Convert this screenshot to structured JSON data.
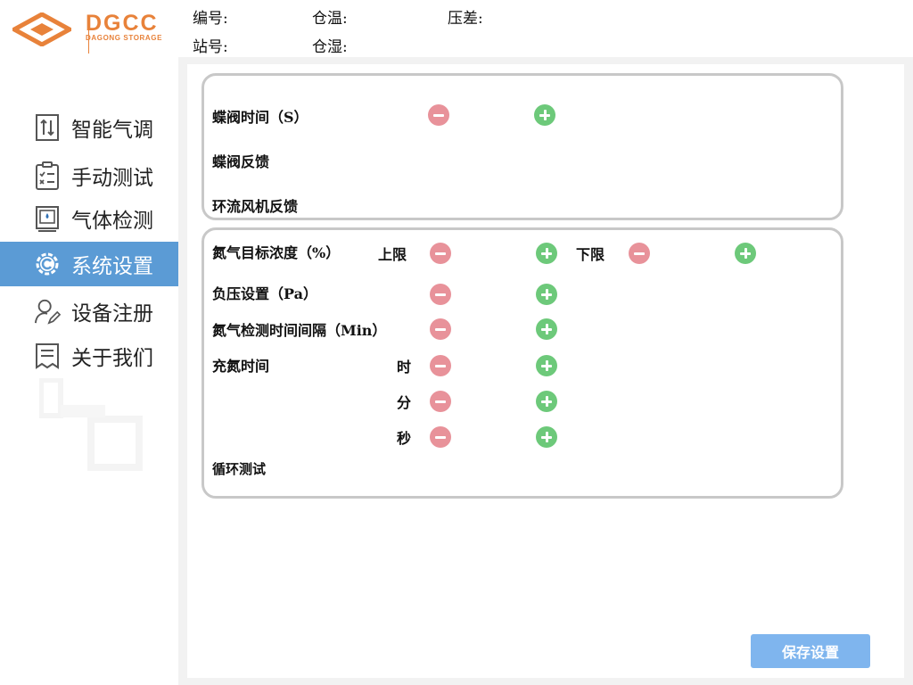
{
  "brand": {
    "name": "DGCC",
    "subtitle": "DAGONG STORAGE",
    "color": "#e8823a"
  },
  "header": {
    "labels": [
      "编号:",
      "仓温:",
      "压差:",
      "站号:",
      "仓湿:"
    ]
  },
  "sidebar": {
    "items": [
      {
        "label": "智能气调",
        "icon": "air-adjust-icon",
        "active": false
      },
      {
        "label": "手动测试",
        "icon": "checklist-icon",
        "active": false
      },
      {
        "label": "气体检测",
        "icon": "gas-monitor-icon",
        "active": false
      },
      {
        "label": "系统设置",
        "icon": "gear-icon",
        "active": true
      },
      {
        "label": "设备注册",
        "icon": "user-register-icon",
        "active": false
      },
      {
        "label": "关于我们",
        "icon": "document-icon",
        "active": false
      }
    ]
  },
  "panel1": {
    "butterfly_time": "蝶阀时间（S）",
    "butterfly_feedback": "蝶阀反馈",
    "fan_feedback": "环流风机反馈"
  },
  "panel2": {
    "nitrogen_target": "氮气目标浓度（%）",
    "upper": "上限",
    "lower": "下限",
    "negative_pressure": "负压设置（Pa）",
    "detect_interval": "氮气检测时间间隔（Min）",
    "fill_time": "充氮时间",
    "hour": "时",
    "minute": "分",
    "second": "秒",
    "cycle_test": "循环测试"
  },
  "actions": {
    "save": "保存设置"
  },
  "colors": {
    "accent": "#5b9bd5",
    "minus": "#e8929a",
    "plus": "#6dc97a",
    "save": "#7fb5ee"
  }
}
